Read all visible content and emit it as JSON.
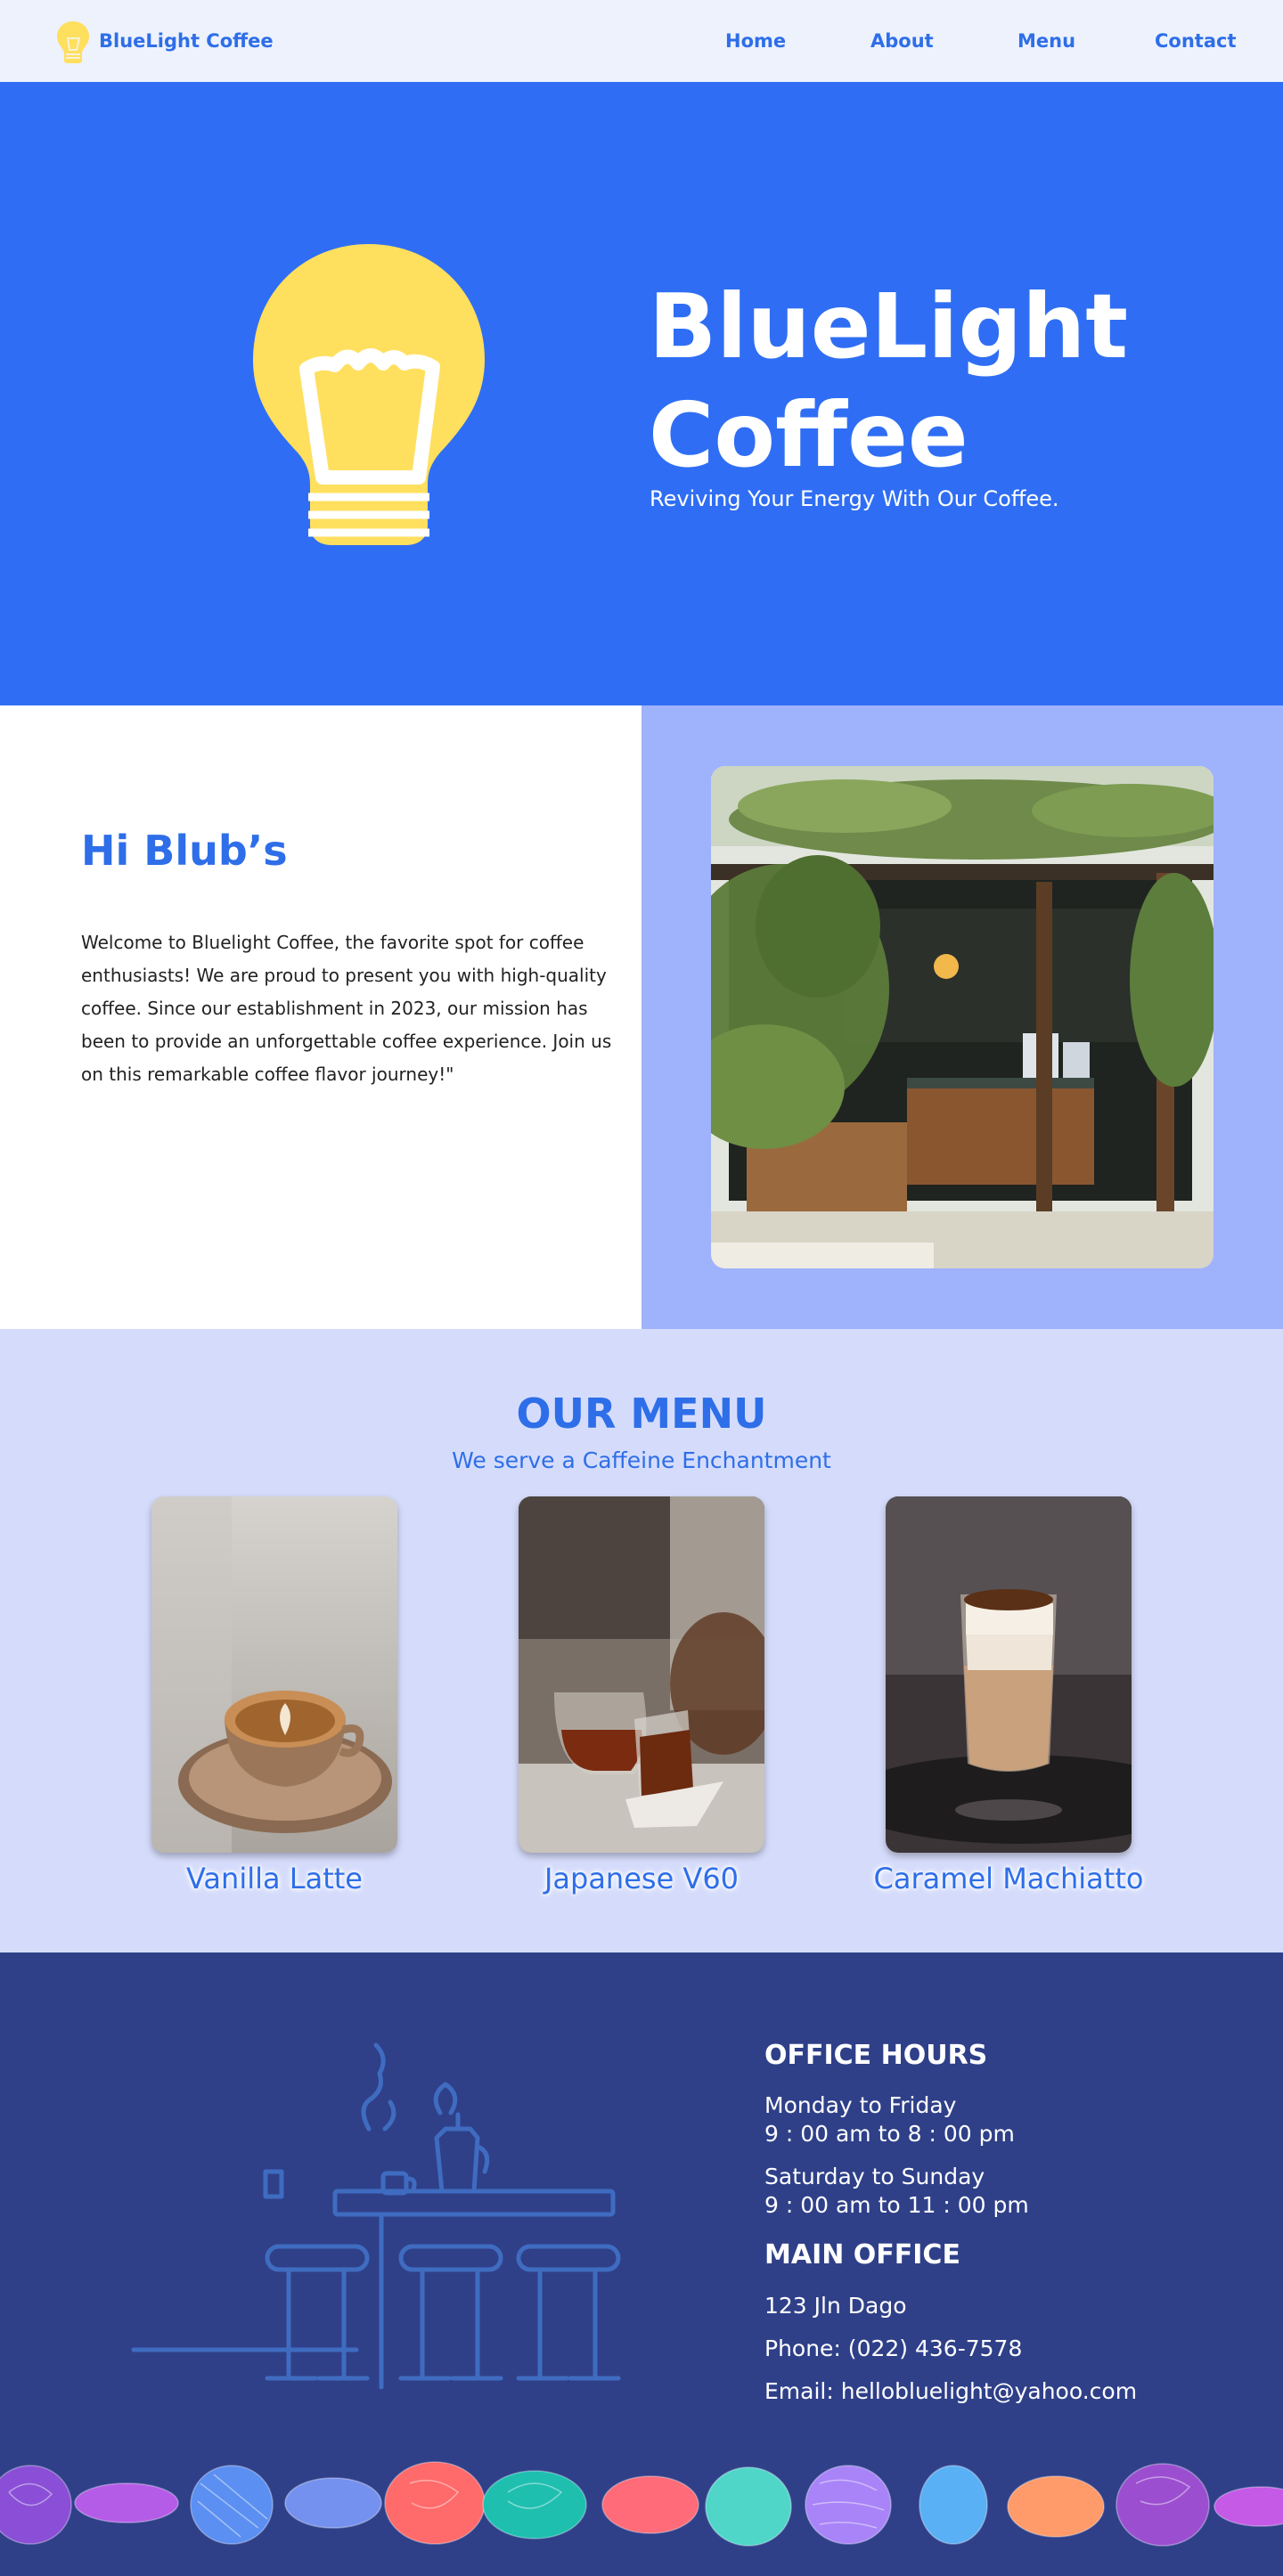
{
  "nav": {
    "brand": "BlueLight Coffee",
    "links": [
      "Home",
      "About",
      "Menu",
      "Contact"
    ]
  },
  "hero": {
    "title_line1": "BlueLight",
    "title_line2": "Coffee",
    "subtitle": "Reviving Your Energy With Our Coffee."
  },
  "about": {
    "title": "Hi Blub’s",
    "text": "Welcome to Bluelight Coffee, the favorite spot for coffee enthusiasts! We are proud to present you with high-quality coffee. Since our establishment in 2023, our mission has been to provide an unforgettable coffee experience. Join us on this remarkable coffee flavor journey!\""
  },
  "menu": {
    "title": "OUR MENU",
    "subtitle": "We serve a Caffeine Enchantment",
    "items": [
      {
        "name": "Vanilla Latte"
      },
      {
        "name": "Japanese V60"
      },
      {
        "name": "Caramel Machiatto"
      }
    ]
  },
  "footer": {
    "hours_title": "OFFICE HOURS",
    "weekday_label": "Monday to Friday",
    "weekday_hours": "9 : 00 am to 8 : 00 pm",
    "weekend_label": "Saturday to Sunday",
    "weekend_hours": "9 : 00 am to 11 : 00 pm",
    "office_title": "MAIN OFFICE",
    "address": "123 Jln Dago",
    "phone": "Phone: (022) 436-7578",
    "email": "Email: hellobluelight@yahoo.com"
  },
  "colors": {
    "accent": "#2e6ee8",
    "hero_bg": "#2f6ef4",
    "bulb": "#ffdf5e",
    "about_right_bg": "#9fb2fc",
    "menu_bg": "#d5dcfb",
    "footer_bg": "#2f4089"
  },
  "icons": [
    "lightbulb-icon",
    "lightbulb-logo-icon"
  ]
}
